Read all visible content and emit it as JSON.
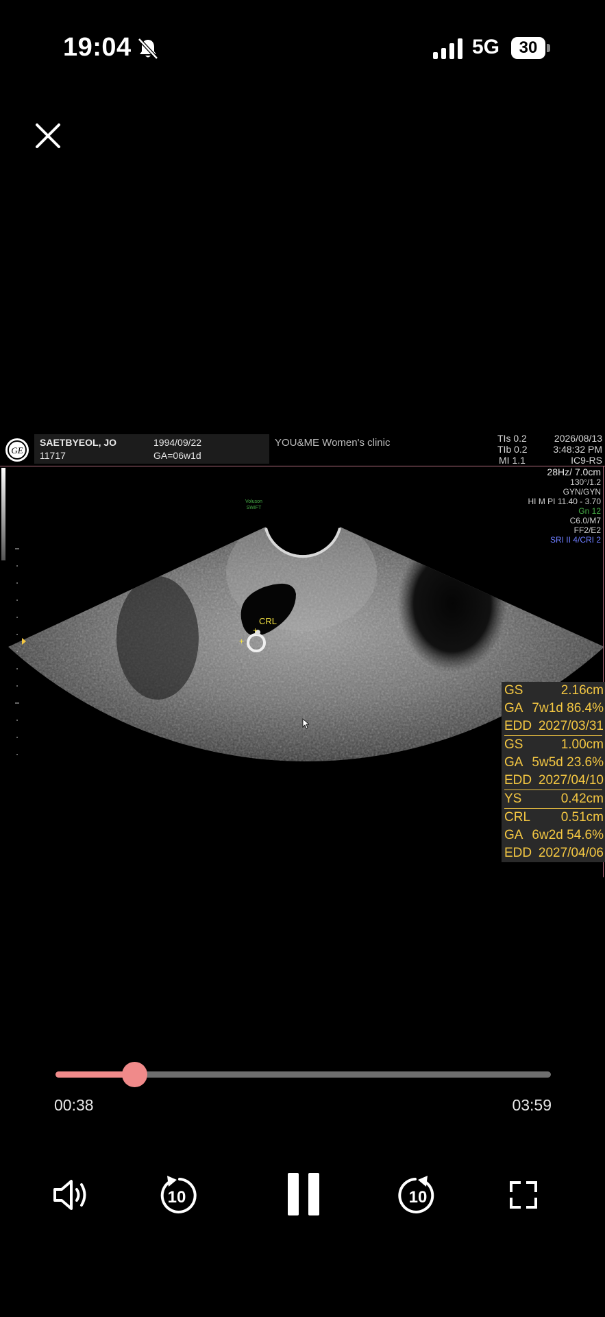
{
  "status_bar": {
    "time": "19:04",
    "network": "5G",
    "battery": "30",
    "icons": [
      "bell-slash-icon",
      "signal-bars-icon",
      "battery-icon"
    ]
  },
  "viewer": {
    "close_icon": "close-icon"
  },
  "ultrasound": {
    "patient_name": "SAETBYEOL, JO",
    "patient_id": "11717",
    "dob": "1994/09/22",
    "ga_header": "GA=06w1d",
    "clinic": "YOU&ME Women's clinic",
    "tis": "TIs 0.2",
    "tib": "TIb 0.2",
    "mi": "MI 1.1",
    "date": "2026/08/13",
    "time": "3:48:32 PM",
    "probe": "IC9-RS",
    "params": [
      "28Hz/ 7.0cm",
      "130°/1.2",
      "GYN/GYN",
      "HI M PI 11.40 - 3.70",
      "Gn 12",
      "C6.0/M7",
      "FF2/E2",
      "SRI II 4/CRI 2"
    ],
    "brand_line1": "Voluson",
    "brand_line2": "SWIFT",
    "crl_label": "CRL",
    "colors": {
      "accent_text": "#f5c842",
      "param_green": "#48b048",
      "param_blue": "#6d7dff"
    },
    "measurements": [
      {
        "label": "GS",
        "value": "2.16cm"
      },
      {
        "label": "GA",
        "value": "7w1d 86.4%"
      },
      {
        "label": "EDD",
        "value": "2027/03/31"
      },
      {
        "label": "GS",
        "value": "1.00cm"
      },
      {
        "label": "GA",
        "value": "5w5d 23.6%"
      },
      {
        "label": "EDD",
        "value": "2027/04/10"
      },
      {
        "label": "YS",
        "value": "0.42cm"
      },
      {
        "label": "CRL",
        "value": "0.51cm"
      },
      {
        "label": "GA",
        "value": "6w2d 54.6%"
      },
      {
        "label": "EDD",
        "value": "2027/04/06"
      }
    ]
  },
  "player": {
    "elapsed": "00:38",
    "duration": "03:59",
    "progress": 0.159,
    "skip_back_seconds": "10",
    "skip_forward_seconds": "10",
    "controls": [
      "volume-icon",
      "skip-back-10-icon",
      "pause-icon",
      "skip-forward-10-icon",
      "fullscreen-icon"
    ],
    "accent_color": "#f08a8a"
  }
}
